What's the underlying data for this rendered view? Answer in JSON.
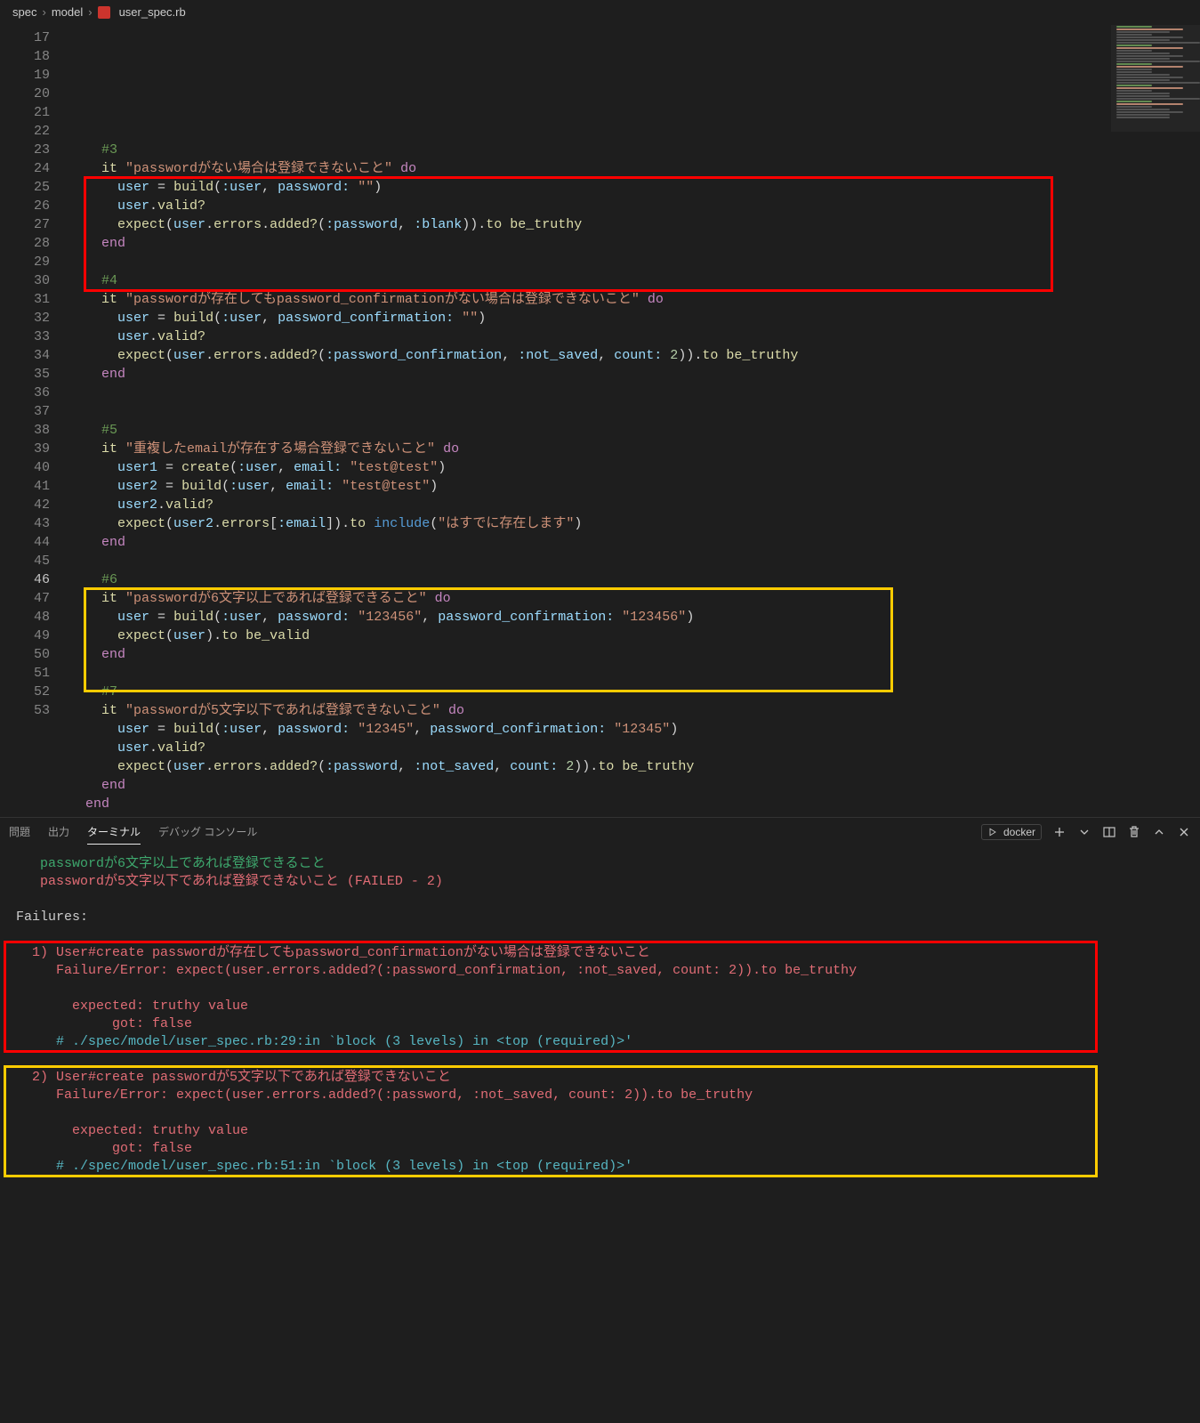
{
  "breadcrumb": {
    "seg1": "spec",
    "seg2": "model",
    "seg3": "user_spec.rb"
  },
  "gutter": {
    "start": 17,
    "end": 53,
    "current": 46
  },
  "code_lines": [
    {
      "n": 17,
      "html": ""
    },
    {
      "n": 18,
      "html": "    <span class='c-com'>#3</span>"
    },
    {
      "n": 19,
      "html": "    <span class='c-met'>it</span> <span class='c-str'>\"passwordがない場合は登録できないこと\"</span> <span class='c-kw'>do</span>"
    },
    {
      "n": 20,
      "html": "      <span class='c-obj'>user</span> <span class='c-punc'>=</span> <span class='c-met'>build</span><span class='c-punc'>(</span><span class='c-sym'>:user</span><span class='c-punc'>,</span> <span class='c-sym'>password:</span> <span class='c-str'>\"\"</span><span class='c-punc'>)</span>"
    },
    {
      "n": 21,
      "html": "      <span class='c-obj'>user</span><span class='c-punc'>.</span><span class='c-met'>valid?</span>"
    },
    {
      "n": 22,
      "html": "      <span class='c-met'>expect</span><span class='c-punc'>(</span><span class='c-obj'>user</span><span class='c-punc'>.</span><span class='c-met'>errors</span><span class='c-punc'>.</span><span class='c-met'>added?</span><span class='c-punc'>(</span><span class='c-sym'>:password</span><span class='c-punc'>,</span> <span class='c-sym'>:blank</span><span class='c-punc'>))</span><span class='c-punc'>.</span><span class='c-met'>to</span> <span class='c-met'>be_truthy</span>"
    },
    {
      "n": 23,
      "html": "    <span class='c-kw'>end</span>"
    },
    {
      "n": 24,
      "html": ""
    },
    {
      "n": 25,
      "html": "    <span class='c-com'>#4</span>"
    },
    {
      "n": 26,
      "html": "    <span class='c-met'>it</span> <span class='c-str'>\"passwordが存在してもpassword_confirmationがない場合は登録できないこと\"</span> <span class='c-kw'>do</span>"
    },
    {
      "n": 27,
      "html": "      <span class='c-obj'>user</span> <span class='c-punc'>=</span> <span class='c-met'>build</span><span class='c-punc'>(</span><span class='c-sym'>:user</span><span class='c-punc'>,</span> <span class='c-sym'>password_confirmation:</span> <span class='c-str'>\"\"</span><span class='c-punc'>)</span>"
    },
    {
      "n": 28,
      "html": "      <span class='c-obj'>user</span><span class='c-punc'>.</span><span class='c-met'>valid?</span>"
    },
    {
      "n": 29,
      "html": "      <span class='c-met'>expect</span><span class='c-punc'>(</span><span class='c-obj'>user</span><span class='c-punc'>.</span><span class='c-met'>errors</span><span class='c-punc'>.</span><span class='c-met'>added?</span><span class='c-punc'>(</span><span class='c-sym'>:password_confirmation</span><span class='c-punc'>,</span> <span class='c-sym'>:not_saved</span><span class='c-punc'>,</span> <span class='c-sym'>count:</span> <span class='c-num'>2</span><span class='c-punc'>))</span><span class='c-punc'>.</span><span class='c-met'>to</span> <span class='c-met'>be_truthy</span>"
    },
    {
      "n": 30,
      "html": "    <span class='c-kw'>end</span>"
    },
    {
      "n": 31,
      "html": ""
    },
    {
      "n": 32,
      "html": ""
    },
    {
      "n": 33,
      "html": "    <span class='c-com'>#5</span>"
    },
    {
      "n": 34,
      "html": "    <span class='c-met'>it</span> <span class='c-str'>\"重複したemailが存在する場合登録できないこと\"</span> <span class='c-kw'>do</span>"
    },
    {
      "n": 35,
      "html": "      <span class='c-obj'>user1</span> <span class='c-punc'>=</span> <span class='c-met'>create</span><span class='c-punc'>(</span><span class='c-sym'>:user</span><span class='c-punc'>,</span> <span class='c-sym'>email:</span> <span class='c-str'>\"test@test\"</span><span class='c-punc'>)</span>"
    },
    {
      "n": 36,
      "html": "      <span class='c-obj'>user2</span> <span class='c-punc'>=</span> <span class='c-met'>build</span><span class='c-punc'>(</span><span class='c-sym'>:user</span><span class='c-punc'>,</span> <span class='c-sym'>email:</span> <span class='c-str'>\"test@test\"</span><span class='c-punc'>)</span>"
    },
    {
      "n": 37,
      "html": "      <span class='c-obj'>user2</span><span class='c-punc'>.</span><span class='c-met'>valid?</span>"
    },
    {
      "n": 38,
      "html": "      <span class='c-met'>expect</span><span class='c-punc'>(</span><span class='c-obj'>user2</span><span class='c-punc'>.</span><span class='c-met'>errors</span><span class='c-punc'>[</span><span class='c-sym'>:email</span><span class='c-punc'>])</span><span class='c-punc'>.</span><span class='c-met'>to</span> <span class='c-blue'>include</span><span class='c-punc'>(</span><span class='c-str'>\"はすでに存在します\"</span><span class='c-punc'>)</span>"
    },
    {
      "n": 39,
      "html": "    <span class='c-kw'>end</span>"
    },
    {
      "n": 40,
      "html": ""
    },
    {
      "n": 41,
      "html": "    <span class='c-com'>#6</span>"
    },
    {
      "n": 42,
      "html": "    <span class='c-met'>it</span> <span class='c-str'>\"passwordが6文字以上であれば登録できること\"</span> <span class='c-kw'>do</span>"
    },
    {
      "n": 43,
      "html": "      <span class='c-obj'>user</span> <span class='c-punc'>=</span> <span class='c-met'>build</span><span class='c-punc'>(</span><span class='c-sym'>:user</span><span class='c-punc'>,</span> <span class='c-sym'>password:</span> <span class='c-str'>\"123456\"</span><span class='c-punc'>,</span> <span class='c-sym'>password_confirmation:</span> <span class='c-str'>\"123456\"</span><span class='c-punc'>)</span>"
    },
    {
      "n": 44,
      "html": "      <span class='c-met'>expect</span><span class='c-punc'>(</span><span class='c-obj'>user</span><span class='c-punc'>)</span><span class='c-punc'>.</span><span class='c-met'>to</span> <span class='c-met'>be_valid</span>"
    },
    {
      "n": 45,
      "html": "    <span class='c-kw'>end</span>"
    },
    {
      "n": 46,
      "html": "",
      "cur": true
    },
    {
      "n": 47,
      "html": "    <span class='c-com'>#7</span>"
    },
    {
      "n": 48,
      "html": "    <span class='c-met'>it</span> <span class='c-str'>\"passwordが5文字以下であれば登録できないこと\"</span> <span class='c-kw'>do</span>"
    },
    {
      "n": 49,
      "html": "      <span class='c-obj'>user</span> <span class='c-punc'>=</span> <span class='c-met'>build</span><span class='c-punc'>(</span><span class='c-sym'>:user</span><span class='c-punc'>,</span> <span class='c-sym'>password:</span> <span class='c-str'>\"12345\"</span><span class='c-punc'>,</span> <span class='c-sym'>password_confirmation:</span> <span class='c-str'>\"12345\"</span><span class='c-punc'>)</span>"
    },
    {
      "n": 50,
      "html": "      <span class='c-obj'>user</span><span class='c-punc'>.</span><span class='c-met'>valid?</span>"
    },
    {
      "n": 51,
      "html": "      <span class='c-met'>expect</span><span class='c-punc'>(</span><span class='c-obj'>user</span><span class='c-punc'>.</span><span class='c-met'>errors</span><span class='c-punc'>.</span><span class='c-met'>added?</span><span class='c-punc'>(</span><span class='c-sym'>:password</span><span class='c-punc'>,</span> <span class='c-sym'>:not_saved</span><span class='c-punc'>,</span> <span class='c-sym'>count:</span> <span class='c-num'>2</span><span class='c-punc'>))</span><span class='c-punc'>.</span><span class='c-met'>to</span> <span class='c-met'>be_truthy</span>"
    },
    {
      "n": 52,
      "html": "    <span class='c-kw'>end</span>"
    },
    {
      "n": 53,
      "html": "  <span class='c-kw'>end</span>"
    }
  ],
  "panel": {
    "tabs": {
      "problems": "問題",
      "output": "出力",
      "terminal": "ターミナル",
      "debug_console": "デバッグ コンソール"
    },
    "active_tab": "terminal",
    "right": {
      "shell_label": "docker"
    }
  },
  "terminal_html": "   <span class='t-green'>passwordが6文字以上であれば登録できること</span>\n   <span class='t-red'>passwordが5文字以下であれば登録できないこと (FAILED - 2)</span>\n\n<span class='t-white'>Failures:</span>\n\n<span class='t-red'>  1) User#create passwordが存在してもpassword_confirmationがない場合は登録できないこと</span>\n<span class='t-red'>     Failure/Error: expect(user.errors.added?(:password_confirmation, :not_saved, count: 2)).to be_truthy</span>\n\n<span class='t-red'>       expected: truthy value</span>\n<span class='t-red'>            got: false</span>\n<span class='t-cyan'>     # ./spec/model/user_spec.rb:29:in `block (3 levels) in &lt;top (required)&gt;'</span>\n\n<span class='t-red'>  2) User#create passwordが5文字以下であれば登録できないこと</span>\n<span class='t-red'>     Failure/Error: expect(user.errors.added?(:password, :not_saved, count: 2)).to be_truthy</span>\n\n<span class='t-red'>       expected: truthy value</span>\n<span class='t-red'>            got: false</span>\n<span class='t-cyan'>     # ./spec/model/user_spec.rb:51:in `block (3 levels) in &lt;top (required)&gt;'</span>"
}
